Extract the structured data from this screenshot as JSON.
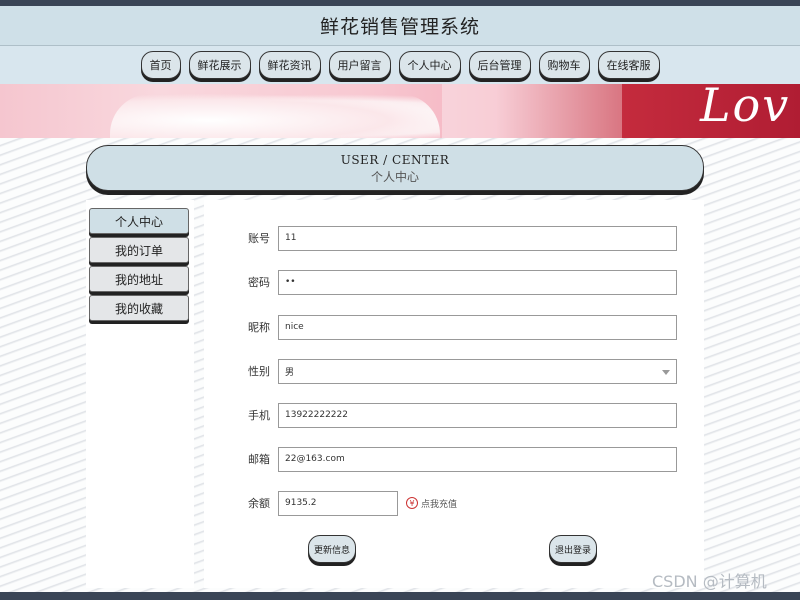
{
  "header": {
    "title": "鲜花销售管理系统"
  },
  "nav": {
    "items": [
      "首页",
      "鲜花展示",
      "鲜花资讯",
      "用户留言",
      "个人中心",
      "后台管理",
      "购物车",
      "在线客服"
    ]
  },
  "banner": {
    "text": "Lov"
  },
  "section": {
    "title_en": "USER / CENTER",
    "title_cn": "个人中心"
  },
  "sidebar": {
    "items": [
      {
        "label": "个人中心",
        "active": true
      },
      {
        "label": "我的订单",
        "active": false
      },
      {
        "label": "我的地址",
        "active": false
      },
      {
        "label": "我的收藏",
        "active": false
      }
    ]
  },
  "form": {
    "account": {
      "label": "账号",
      "value": "11"
    },
    "password": {
      "label": "密码",
      "value": "••"
    },
    "nickname": {
      "label": "昵称",
      "value": "nice"
    },
    "gender": {
      "label": "性别",
      "value": "男"
    },
    "phone": {
      "label": "手机",
      "value": "13922222222"
    },
    "email": {
      "label": "邮箱",
      "value": "22@163.com"
    },
    "balance": {
      "label": "余额",
      "value": "9135.2",
      "recharge": "点我充值",
      "icon": "yen-icon"
    },
    "update_button": "更新信息",
    "logout_button": "退出登录"
  },
  "watermark": "CSDN @计算机",
  "colors": {
    "header_bg": "#cfe0e8",
    "accent": "#cfdfe6",
    "button_bg": "#dbe5ea"
  }
}
